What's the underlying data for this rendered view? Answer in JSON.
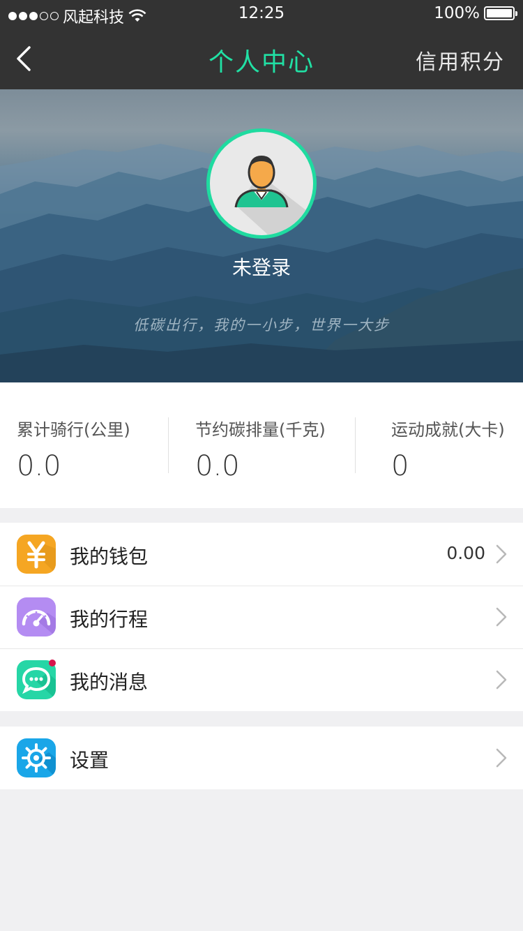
{
  "status_bar": {
    "carrier": "风起科技",
    "time": "12:25",
    "battery": "100%",
    "battery_level": 1.0
  },
  "nav": {
    "title": "个人中心",
    "right_action": "信用积分"
  },
  "profile": {
    "login_status": "未登录",
    "slogan": "低碳出行，我的一小步，世界一大步"
  },
  "stats": [
    {
      "label": "累计骑行(公里)",
      "value": "0.0"
    },
    {
      "label": "节约碳排量(千克)",
      "value": "0.0"
    },
    {
      "label": "运动成就(大卡)",
      "value": "0"
    }
  ],
  "menu": {
    "wallet": {
      "label": "我的钱包",
      "value": "0.00",
      "icon": "wallet-yen-icon"
    },
    "trips": {
      "label": "我的行程",
      "icon": "speedometer-icon"
    },
    "messages": {
      "label": "我的消息",
      "icon": "chat-bubble-icon"
    },
    "settings": {
      "label": "设置",
      "icon": "gear-icon"
    }
  },
  "colors": {
    "accent": "#21e0a4",
    "nav_bg": "#333333",
    "wallet_icon": "#f5a623",
    "trips_icon": "#b48cf2",
    "messages_icon": "#26d6a6",
    "settings_icon": "#1aa6e8",
    "badge": "#d8144c"
  }
}
